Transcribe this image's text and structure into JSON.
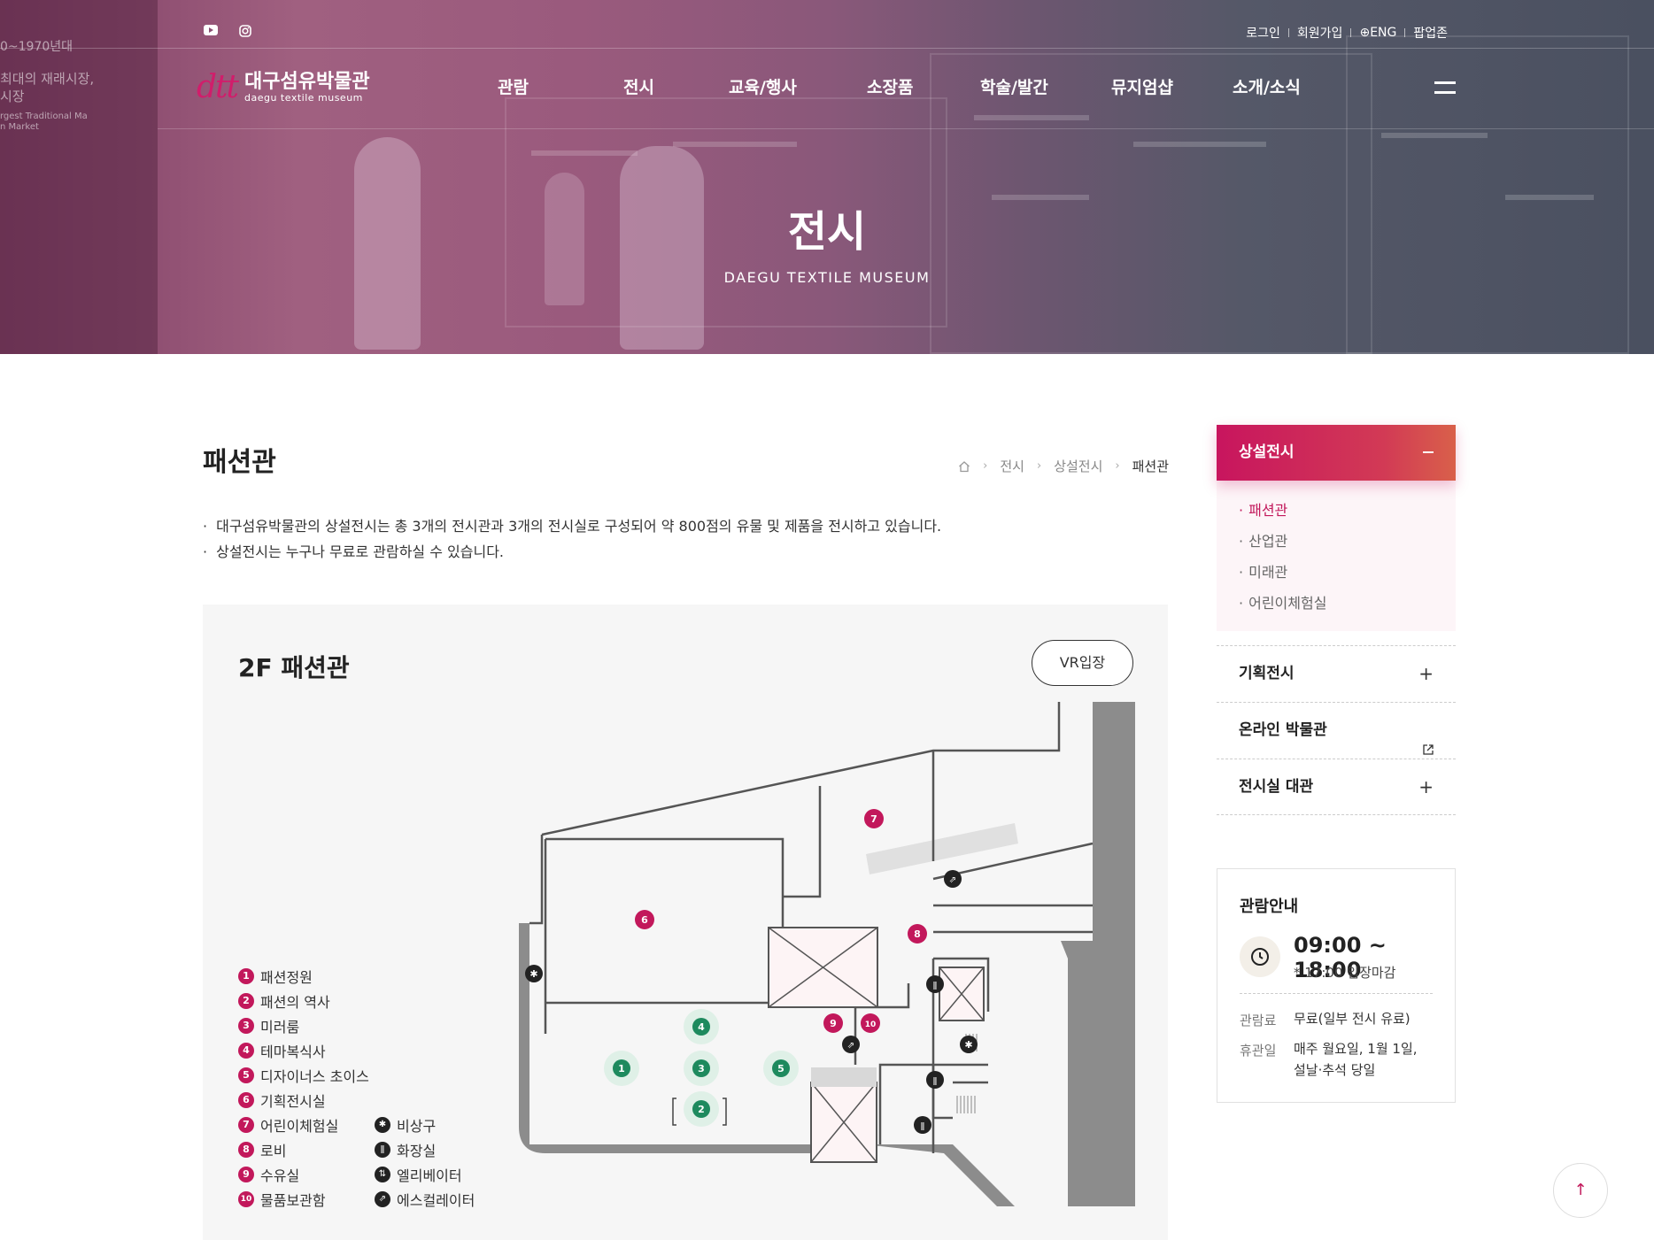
{
  "header": {
    "sns": [
      {
        "icon": "youtube-icon"
      },
      {
        "icon": "instagram-icon"
      }
    ],
    "util": [
      "로그인",
      "회원가입",
      "ENG",
      "팝업존"
    ],
    "logo": {
      "ko": "대구섬유박물관",
      "en": "daegu textile museum",
      "mark": "dtt"
    },
    "nav": [
      "관람",
      "전시",
      "교육/행사",
      "소장품",
      "학술/발간",
      "뮤지엄샵",
      "소개/소식"
    ]
  },
  "hero": {
    "title": "전시",
    "subtitle": "DAEGU TEXTILE MUSEUM",
    "bg_text": [
      "0~1970년대",
      "최대의 재래시장,",
      "시장",
      "rgest Traditional Ma",
      "n Market"
    ]
  },
  "page": {
    "title": "패션관",
    "breadcrumb": [
      "전시",
      "상설전시",
      "패션관"
    ],
    "intro": [
      "대구섬유박물관의 상설전시는 총 3개의 전시관과 3개의 전시실로 구성되어 약 800점의 유물 및 제품을 전시하고 있습니다.",
      "상설전시는 누구나 무료로 관람하실 수 있습니다."
    ]
  },
  "map": {
    "title": "2F 패션관",
    "vr_label": "VR입장",
    "legend": [
      {
        "num": "1",
        "label": "패션정원"
      },
      {
        "num": "2",
        "label": "패션의 역사"
      },
      {
        "num": "3",
        "label": "미러룸"
      },
      {
        "num": "4",
        "label": "테마복식사"
      },
      {
        "num": "5",
        "label": "디자이너스 초이스"
      },
      {
        "num": "6",
        "label": "기획전시실"
      },
      {
        "num": "7",
        "label": "어린이체험실"
      },
      {
        "num": "8",
        "label": "로비"
      },
      {
        "num": "9",
        "label": "수유실"
      },
      {
        "num": "10",
        "label": "물품보관함"
      }
    ],
    "facilities": [
      {
        "icon": "emergency-exit-icon",
        "label": "비상구"
      },
      {
        "icon": "restroom-icon",
        "label": "화장실"
      },
      {
        "icon": "elevator-icon",
        "label": "엘리베이터"
      },
      {
        "icon": "escalator-icon",
        "label": "에스컬레이터"
      }
    ],
    "markers": [
      "1",
      "2",
      "3",
      "4",
      "5",
      "6",
      "7",
      "8",
      "9",
      "10"
    ]
  },
  "sidebar": {
    "active_group": "상설전시",
    "sub_items": [
      "패션관",
      "산업관",
      "미래관",
      "어린이체험실"
    ],
    "groups": [
      {
        "label": "기획전시",
        "action": "plus"
      },
      {
        "label": "온라인 박물관",
        "action": "external"
      },
      {
        "label": "전시실 대관",
        "action": "plus"
      }
    ],
    "info": {
      "title": "관람안내",
      "time": "09:00 ~ 18:00",
      "note": "* 17:00 입장마감",
      "fee_label": "관람료",
      "fee": "무료(일부 전시 유료)",
      "closed_label": "휴관일",
      "closed_line1": "매주 월요일, 1월 1일,",
      "closed_line2": "설날·추석 당일"
    }
  },
  "colors": {
    "accent": "#c2185b",
    "green": "#1e8a5e",
    "floor_wall": "#8c8c8c"
  }
}
